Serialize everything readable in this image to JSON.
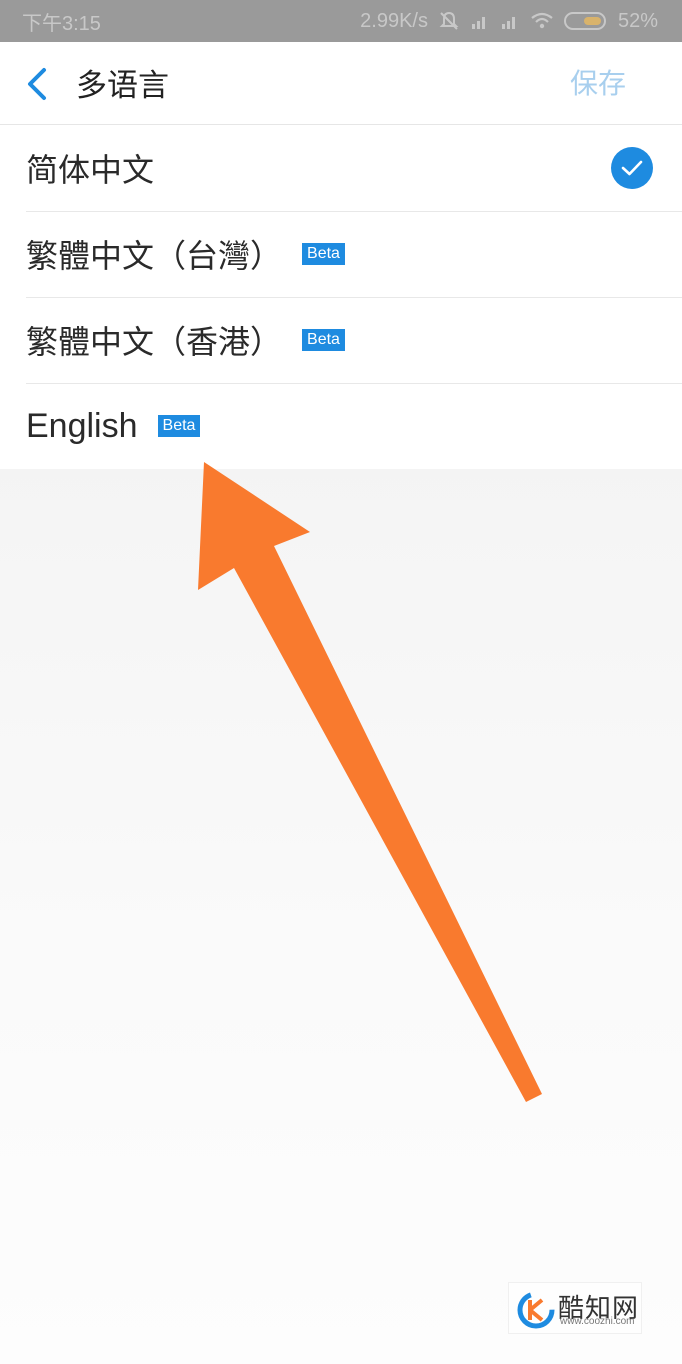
{
  "status_bar": {
    "time": "下午3:15",
    "speed": "2.99K/s",
    "battery": "52%"
  },
  "header": {
    "title": "多语言",
    "save_label": "保存"
  },
  "languages": [
    {
      "label": "简体中文",
      "beta": "",
      "selected": true
    },
    {
      "label": "繁體中文（台灣）",
      "beta": "Beta",
      "selected": false
    },
    {
      "label": "繁體中文（香港）",
      "beta": "Beta",
      "selected": false
    },
    {
      "label": "English",
      "beta": "Beta",
      "selected": false
    }
  ],
  "watermark": {
    "title": "酷知网",
    "url": "www.coozhi.com"
  },
  "colors": {
    "accent": "#1e8be0",
    "arrow": "#f97a2e"
  }
}
